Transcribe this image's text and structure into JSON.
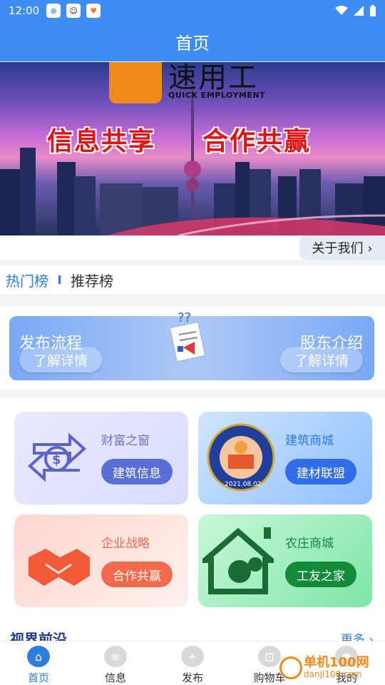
{
  "status_bar": {
    "time": "12:00",
    "apps": [
      "app-1",
      "app-2",
      "app-3"
    ]
  },
  "header": {
    "title": "首页"
  },
  "banner": {
    "logo_text": "速用工",
    "logo_sub": "QUICK EMPLOYMENT",
    "slogan_left": "信息共享",
    "slogan_right": "合作共赢"
  },
  "about_button": "关于我们 ›",
  "tabs": {
    "active": "热门榜",
    "inactive": "推荐榜"
  },
  "process_panel": {
    "left_title": "发布流程",
    "left_button": "了解详情",
    "right_title": "股东介绍",
    "right_button": "了解详情"
  },
  "grid": [
    {
      "title": "财富之窗",
      "button": "建筑信息",
      "title_color": "#6b75c4",
      "button_color": "#5a6fd6"
    },
    {
      "title": "建筑商城",
      "button": "建材联盟",
      "title_color": "#2f7de1",
      "button_color": "#2f6ee8",
      "seal_date": "2021.08.02"
    },
    {
      "title": "企业战略",
      "button": "合作共赢",
      "title_color": "#f06a4e",
      "button_color": "#f2694c"
    },
    {
      "title": "农庄商城",
      "button": "工友之家",
      "title_color": "#158a3c",
      "button_color": "#128a3a"
    }
  ],
  "section": {
    "title": "视界前沿",
    "more": "更多 ›"
  },
  "bottom_nav": [
    {
      "label": "首页",
      "icon": "home-icon",
      "active": true
    },
    {
      "label": "信息",
      "icon": "message-icon",
      "active": false
    },
    {
      "label": "发布",
      "icon": "plus-icon",
      "active": false
    },
    {
      "label": "购物车",
      "icon": "cart-icon",
      "active": false
    },
    {
      "label": "我的",
      "icon": "user-icon",
      "active": false
    }
  ],
  "watermark": {
    "text": "单机100网",
    "sub": "danji100.com"
  }
}
